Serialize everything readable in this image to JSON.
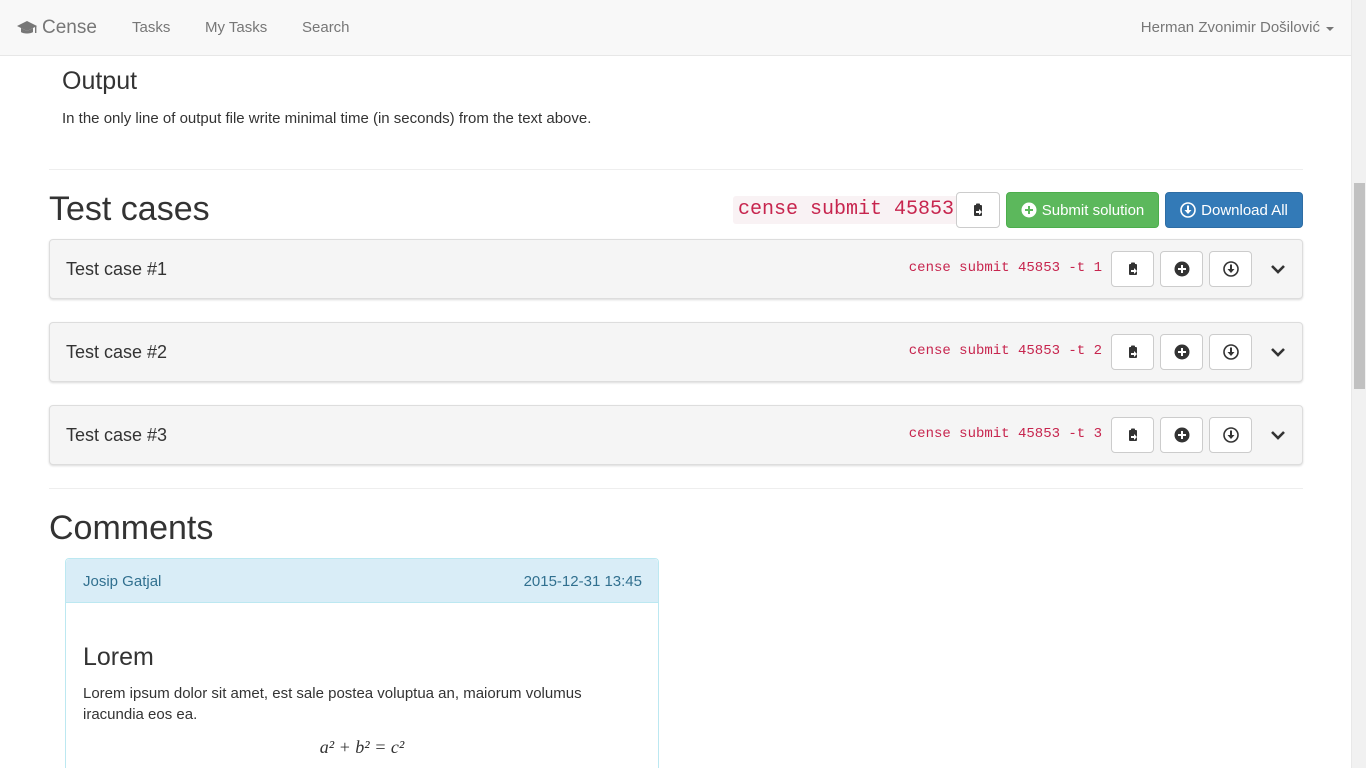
{
  "navbar": {
    "brand": "Cense",
    "links": [
      "Tasks",
      "My Tasks",
      "Search"
    ],
    "user": "Herman Zvonimir Došilović"
  },
  "output": {
    "title": "Output",
    "text": "In the only line of output file write minimal time (in seconds) from the text above."
  },
  "test_cases": {
    "title": "Test cases",
    "command": "cense submit 45853",
    "submit_label": "Submit solution",
    "download_all_label": "Download All",
    "items": [
      {
        "title": "Test case #1",
        "command": "cense submit 45853 -t 1"
      },
      {
        "title": "Test case #2",
        "command": "cense submit 45853 -t 2"
      },
      {
        "title": "Test case #3",
        "command": "cense submit 45853 -t 3"
      }
    ]
  },
  "comments": {
    "title": "Comments",
    "items": [
      {
        "author": "Josip Gatjal",
        "date": "2015-12-31 13:45",
        "heading": "Lorem",
        "body": "Lorem ipsum dolor sit amet, est sale postea voluptua an, maiorum volumus iracundia eos ea.",
        "math": "a² + b² = c²"
      }
    ]
  },
  "colors": {
    "code": "#c7254e",
    "success": "#5cb85c",
    "primary": "#337ab7",
    "comment_header": "#d9edf7"
  }
}
